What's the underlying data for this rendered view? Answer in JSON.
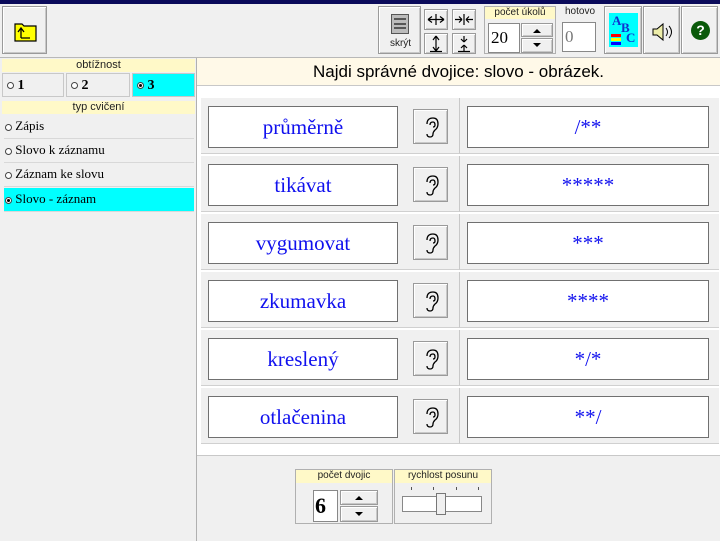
{
  "toolbar": {
    "folder_icon": "folder-up-icon",
    "hide_label": "skrýt",
    "task_count_label": "počet úkolů",
    "task_count_value": "20",
    "done_label": "hotovo",
    "done_value": "0",
    "abc_glyphs": [
      "A",
      "B",
      "C"
    ],
    "help_glyph": "?"
  },
  "sidebar": {
    "difficulty_label": "obtížnost",
    "difficulty_levels": [
      {
        "label": "1",
        "selected": false
      },
      {
        "label": "2",
        "selected": false
      },
      {
        "label": "3",
        "selected": true
      }
    ],
    "exercise_type_label": "typ cvičení",
    "exercise_types": [
      {
        "label": "Zápis",
        "selected": false
      },
      {
        "label": "Slovo k záznamu",
        "selected": false
      },
      {
        "label": "Záznam ke slovu",
        "selected": false
      },
      {
        "label": "Slovo - záznam",
        "selected": true
      }
    ]
  },
  "main": {
    "instruction": "Najdi správné dvojice: slovo - obrázek.",
    "words": [
      "průměrně",
      "tikávat",
      "vygumovat",
      "zkumavka",
      "kreslený",
      "otlačenina"
    ],
    "answers": [
      "/**",
      "*****",
      "***",
      "****",
      "*/*",
      "**/"
    ]
  },
  "bottom": {
    "pairs_label": "počet dvojic",
    "pairs_value": "6",
    "speed_label": "rychlost posunu"
  },
  "colors": {
    "selected": "#00ffff",
    "word_text": "#1010ee",
    "label_bg": "#fff9c8"
  }
}
